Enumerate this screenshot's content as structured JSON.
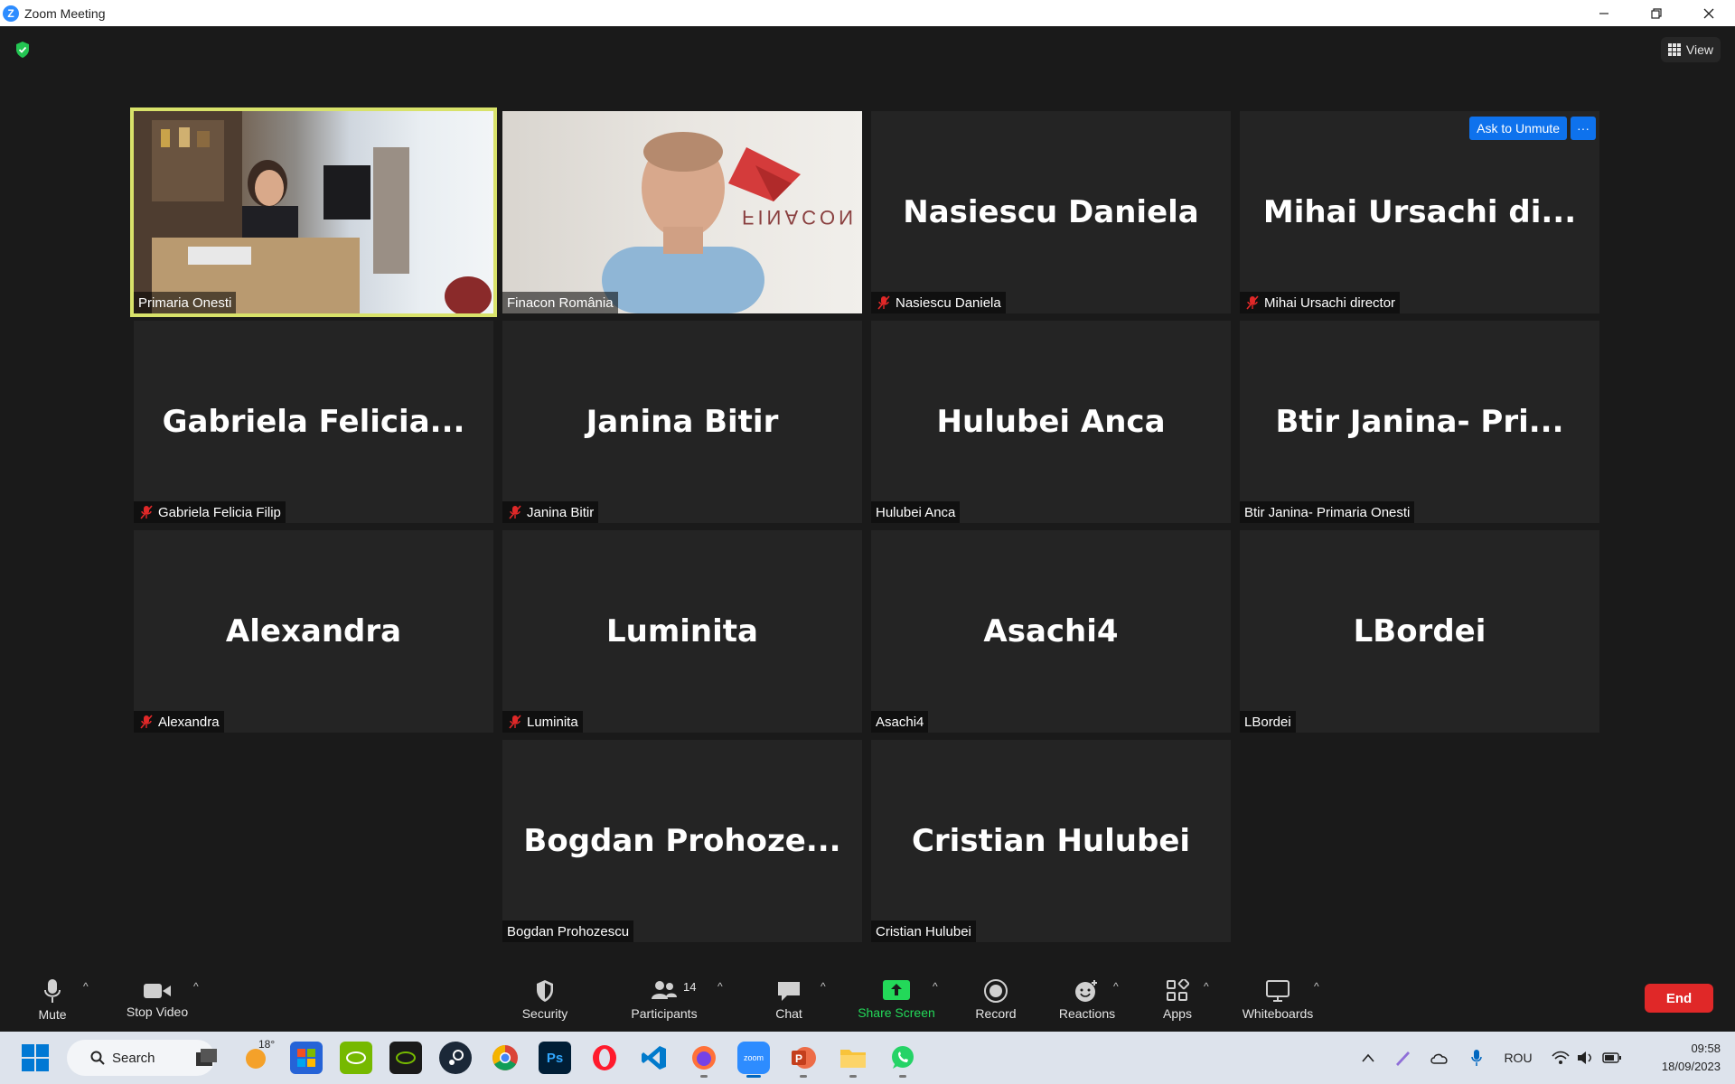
{
  "window": {
    "title": "Zoom Meeting",
    "logo_letter": "Z"
  },
  "meeting": {
    "view_label": "View",
    "ask_unmute_label": "Ask to Unmute",
    "more_label": "···",
    "tiles": [
      {
        "label": "Primaria Onesti",
        "big_name": "",
        "muted": false,
        "video": "vid1",
        "active": true
      },
      {
        "label": "Finacon România",
        "big_name": "",
        "muted": false,
        "video": "vid2",
        "active": false
      },
      {
        "label": "Nasiescu Daniela",
        "big_name": "Nasiescu Daniela",
        "muted": true
      },
      {
        "label": "Mihai Ursachi director",
        "big_name": "Mihai  Ursachi  di...",
        "muted": true
      },
      {
        "label": "Gabriela Felicia Filip",
        "big_name": "Gabriela  Felicia...",
        "muted": true
      },
      {
        "label": "Janina Bitir",
        "big_name": "Janina Bitir",
        "muted": true
      },
      {
        "label": "Hulubei Anca",
        "big_name": "Hulubei Anca",
        "muted": false
      },
      {
        "label": "Btir Janina- Primaria  Onesti",
        "big_name": "Btir Janina-  Pri...",
        "muted": false
      },
      {
        "label": "Alexandra",
        "big_name": "Alexandra",
        "muted": true
      },
      {
        "label": "Luminita",
        "big_name": "Luminita",
        "muted": true
      },
      {
        "label": "Asachi4",
        "big_name": "Asachi4",
        "muted": false
      },
      {
        "label": "LBordei",
        "big_name": "LBordei",
        "muted": false
      },
      {
        "label": "Bogdan Prohozescu",
        "big_name": "Bogdan  Prohoze...",
        "muted": false
      },
      {
        "label": "Cristian Hulubei",
        "big_name": "Cristian Hulubei",
        "muted": false
      }
    ],
    "finacon_logo_text": "FINACON"
  },
  "toolbar": {
    "mute": "Mute",
    "stop_video": "Stop Video",
    "security": "Security",
    "participants": "Participants",
    "participants_count": "14",
    "chat": "Chat",
    "share_screen": "Share Screen",
    "record": "Record",
    "reactions": "Reactions",
    "apps": "Apps",
    "whiteboards": "Whiteboards",
    "end": "End",
    "caret": "^"
  },
  "taskbar": {
    "search_label": "Search",
    "weather_temp": "18°",
    "language": "ROU",
    "time": "09:58",
    "date": "18/09/2023",
    "apps": [
      "file-explorer-task-view",
      "weather",
      "microsoft-store",
      "nvidia",
      "nvidia-app",
      "steam",
      "chrome",
      "photoshop",
      "opera",
      "vscode",
      "firefox",
      "zoom",
      "powerpoint",
      "file-explorer",
      "whatsapp"
    ],
    "ps_label": "Ps",
    "zoom_label": "zoom"
  },
  "colors": {
    "accent": "#0e72ed",
    "share_green": "#23d959",
    "end_red": "#e02828",
    "active_border": "#d8e26a"
  }
}
